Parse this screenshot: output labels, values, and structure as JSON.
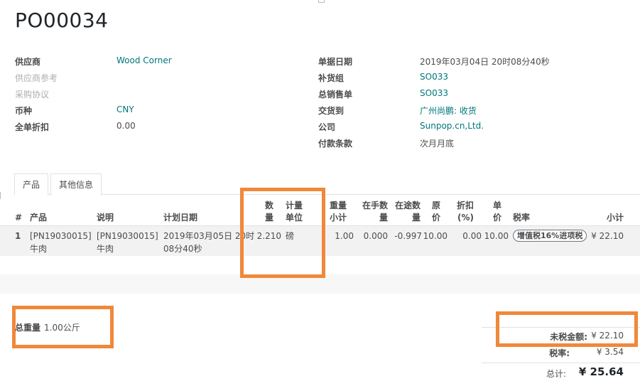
{
  "title": "PO00034",
  "left_fields": [
    {
      "label": "供应商",
      "value": "Wood Corner",
      "value_link": true,
      "muted": false
    },
    {
      "label": "供应商参考",
      "value": "",
      "value_link": false,
      "muted": true
    },
    {
      "label": "采购协议",
      "value": "",
      "value_link": false,
      "muted": true
    },
    {
      "label": "币种",
      "value": "CNY",
      "value_link": true,
      "muted": false
    },
    {
      "label": "全单折扣",
      "value": "0.00",
      "value_link": false,
      "muted": false
    }
  ],
  "right_fields": [
    {
      "label": "单据日期",
      "value": "2019年03月04日 20时08分40秒",
      "value_link": false
    },
    {
      "label": "补货组",
      "value": "SO033",
      "value_link": true
    },
    {
      "label": "总销售单",
      "value": "SO033",
      "value_link": true
    },
    {
      "label": "交货到",
      "value": "广州尚鹏: 收货",
      "value_link": true
    },
    {
      "label": "公司",
      "value": "Sunpop.cn,Ltd.",
      "value_link": true
    },
    {
      "label": "付款条款",
      "value": "次月月底",
      "value_link": false
    }
  ],
  "tabs": [
    {
      "label": "产品",
      "active": true
    },
    {
      "label": "其他信息",
      "active": false
    }
  ],
  "table": {
    "headers": {
      "index": "#",
      "product": "产品",
      "description": "说明",
      "planned_date": "计划日期",
      "qty_1": "数",
      "qty_2": "量",
      "uom_1": "计量",
      "uom_2": "单位",
      "weight_1": "重量",
      "weight_2": "小计",
      "on_hand_1": "在手数",
      "on_hand_2": "量",
      "in_transit_1": "在途数",
      "in_transit_2": "量",
      "price_1": "原",
      "price_2": "价",
      "discount_1": "折扣",
      "discount_2": "(%)",
      "unit_price_1": "单",
      "unit_price_2": "价",
      "tax": "税率",
      "subtotal": "小计"
    },
    "rows": [
      {
        "index": "1",
        "product_1": "[PN19030015]",
        "product_2": "牛肉",
        "description_1": "[PN19030015]",
        "description_2": "牛肉",
        "planned_date_1": "2019年03月05日 20时",
        "planned_date_2": "08分40秒",
        "qty": "2.210",
        "uom": "磅",
        "weight": "1.00",
        "on_hand": "0.000",
        "in_transit": "-0.997",
        "price": "10.00",
        "discount": "0.00",
        "unit_price": "10.00",
        "tax": "增值税16%进项税",
        "subtotal": "¥ 22.10"
      }
    ]
  },
  "total_weight": {
    "label": "总重量",
    "value": "1.00公斤"
  },
  "summary": {
    "untaxed_label": "未税金额:",
    "untaxed_value": "¥ 22.10",
    "tax_label": "税率:",
    "tax_value": "¥ 3.54",
    "total_label": "总计:",
    "total_value": "¥ 25.64"
  },
  "highlight_color": "#f0883a"
}
